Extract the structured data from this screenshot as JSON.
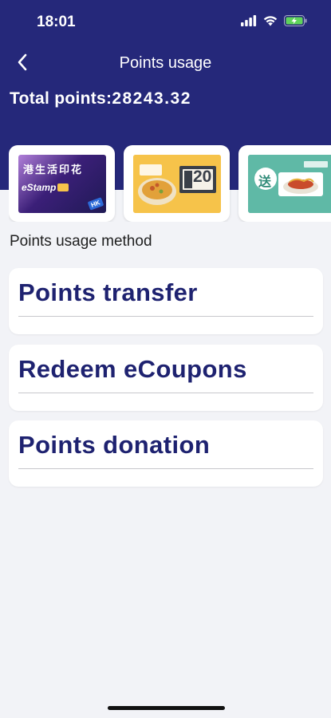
{
  "status_bar": {
    "time": "18:01"
  },
  "nav": {
    "title": "Points usage",
    "back_icon": "chevron-left-icon"
  },
  "summary": {
    "total_label": "Total points:",
    "total_value": "28243.32"
  },
  "cards": [
    {
      "name": "estamp-card",
      "title_cn": "港生活印花",
      "brand": "eStamp",
      "badge": "HK"
    },
    {
      "name": "coupon-20-card",
      "amount": "20"
    },
    {
      "name": "gift-coupon-card",
      "badge_cn": "送"
    }
  ],
  "methods": {
    "section_label": "Points usage method",
    "items": [
      {
        "label": "Points transfer"
      },
      {
        "label": "Redeem eCoupons"
      },
      {
        "label": "Points donation"
      }
    ]
  },
  "colors": {
    "header_bg": "#25287a",
    "method_text": "#1e2270",
    "page_bg": "#f2f3f7",
    "coupon_yellow": "#f6c34a",
    "battery_green": "#5fd35b"
  }
}
